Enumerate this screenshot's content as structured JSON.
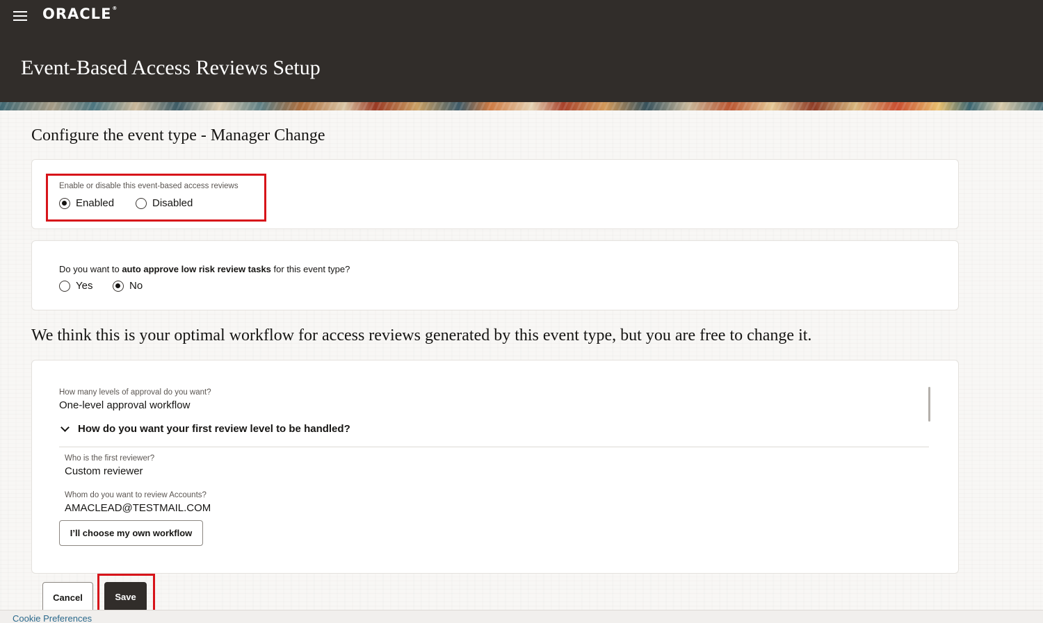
{
  "header": {
    "brand": "ORACLE",
    "brand_mark": "®",
    "page_title": "Event-Based Access Reviews Setup"
  },
  "configure": {
    "heading": "Configure the event type - Manager Change",
    "enable_label": "Enable or disable this event-based access reviews",
    "enable_options": [
      "Enabled",
      "Disabled"
    ],
    "enable_selected": "Enabled",
    "auto_approve": {
      "prefix": "Do you want to ",
      "bold": "auto approve low risk review tasks",
      "suffix": " for this event type?",
      "options": [
        "Yes",
        "No"
      ],
      "selected": "No"
    }
  },
  "workflow": {
    "heading": "We think this is your optimal workflow for access reviews generated by this event type, but you are free to change it.",
    "levels_label": "How many levels of approval do you want?",
    "levels_value": "One-level approval workflow",
    "first_level_title": "How do you want your first review level to be handled?",
    "first_reviewer_label": "Who is the first reviewer?",
    "first_reviewer_value": "Custom reviewer",
    "accounts_reviewer_label": "Whom do you want to review Accounts?",
    "accounts_reviewer_value": "AMACLEAD@TESTMAIL.COM",
    "own_workflow_button": "I’ll choose my own workflow"
  },
  "actions": {
    "cancel": "Cancel",
    "save": "Save"
  },
  "footer": {
    "cookie_preferences": "Cookie Preferences"
  },
  "colors": {
    "header_bg": "#312d2a",
    "highlight": "#d7141a",
    "link": "#2c6a8d"
  },
  "icons": [
    "hamburger-menu-icon",
    "chevron-down-icon"
  ]
}
